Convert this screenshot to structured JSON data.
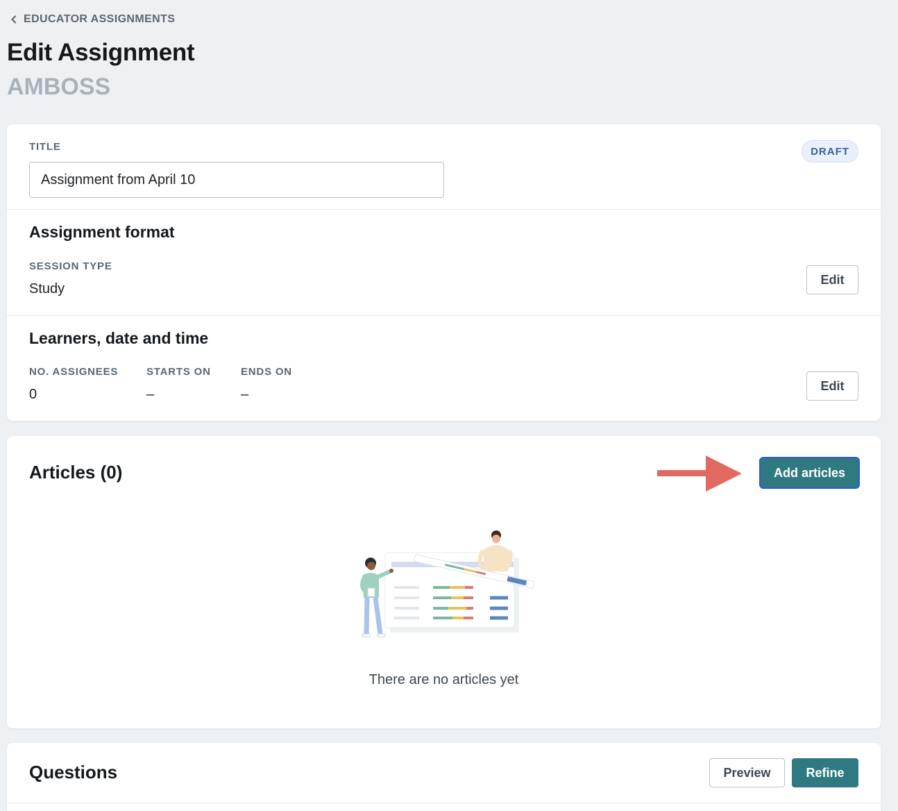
{
  "breadcrumb": {
    "label": "EDUCATOR ASSIGNMENTS"
  },
  "page": {
    "title": "Edit Assignment",
    "subtitle": "AMBOSS"
  },
  "assignment": {
    "title_label": "TITLE",
    "title_value": "Assignment from April 10",
    "status_badge": "DRAFT",
    "format": {
      "heading": "Assignment format",
      "session_type_label": "SESSION TYPE",
      "session_type_value": "Study",
      "edit_label": "Edit"
    },
    "schedule": {
      "heading": "Learners, date and time",
      "assignees_label": "NO. ASSIGNEES",
      "assignees_value": "0",
      "starts_label": "STARTS ON",
      "starts_value": "–",
      "ends_label": "ENDS ON",
      "ends_value": "–",
      "edit_label": "Edit"
    }
  },
  "articles": {
    "heading": "Articles (0)",
    "add_label": "Add articles",
    "empty_text": "There are no articles yet"
  },
  "questions": {
    "heading": "Questions",
    "preview_label": "Preview",
    "refine_label": "Refine"
  },
  "colors": {
    "primary": "#2f7a80",
    "annotation_arrow": "#e06a60",
    "badge_text": "#3b5f9a"
  }
}
